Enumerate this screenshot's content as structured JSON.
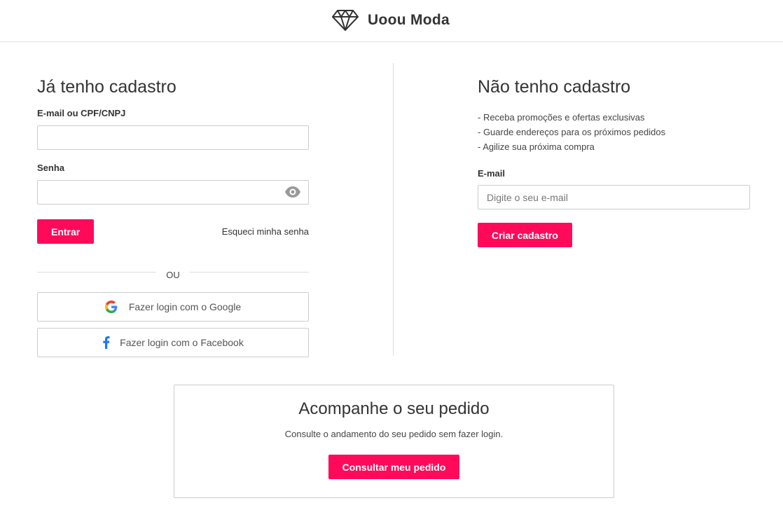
{
  "brand": {
    "name": "Uoou Moda",
    "logo_icon": "diamond-icon",
    "accent_color": "#ff0a5a"
  },
  "login": {
    "title": "Já tenho cadastro",
    "email_label": "E-mail ou CPF/CNPJ",
    "email_value": "",
    "password_label": "Senha",
    "password_value": "",
    "password_toggle_icon": "eye-icon",
    "submit_label": "Entrar",
    "forgot_label": "Esqueci minha senha",
    "or_label": "OU",
    "google_label": "Fazer login com o Google",
    "google_icon": "google-icon",
    "facebook_label": "Fazer login com o Facebook",
    "facebook_icon": "facebook-icon"
  },
  "signup": {
    "title": "Não tenho cadastro",
    "benefits": [
      "- Receba promoções e ofertas exclusivas",
      "- Guarde endereços para os próximos pedidos",
      "- Agilize sua próxima compra"
    ],
    "email_label": "E-mail",
    "email_placeholder": "Digite o seu e-mail",
    "submit_label": "Criar cadastro"
  },
  "tracking": {
    "title": "Acompanhe o seu pedido",
    "description": "Consulte o andamento do seu pedido sem fazer login.",
    "button_label": "Consultar meu pedido"
  }
}
